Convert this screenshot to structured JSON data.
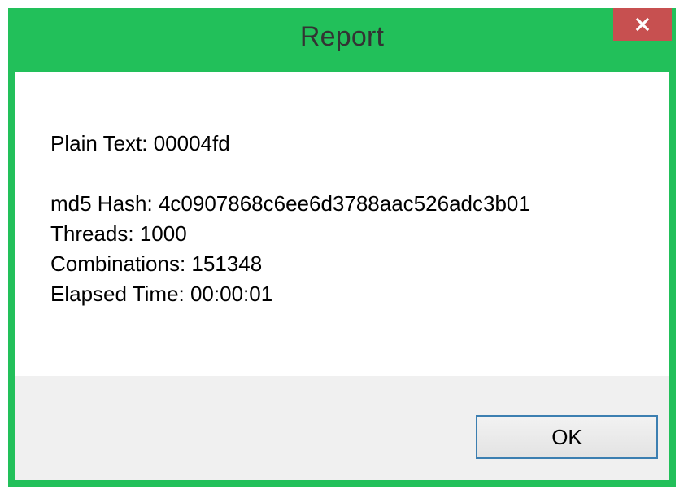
{
  "window": {
    "title": "Report",
    "close_icon": "close-icon",
    "accent_color": "#22c05a",
    "close_color": "#c75050"
  },
  "message": {
    "plain_text": "Plain Text: 00004fd",
    "md5_hash": "md5 Hash: 4c0907868c6ee6d3788aac526adc3b01",
    "threads": "Threads: 1000",
    "combinations": "Combinations: 151348",
    "elapsed_time": "Elapsed Time: 00:00:01"
  },
  "buttons": {
    "ok_label": "OK"
  }
}
